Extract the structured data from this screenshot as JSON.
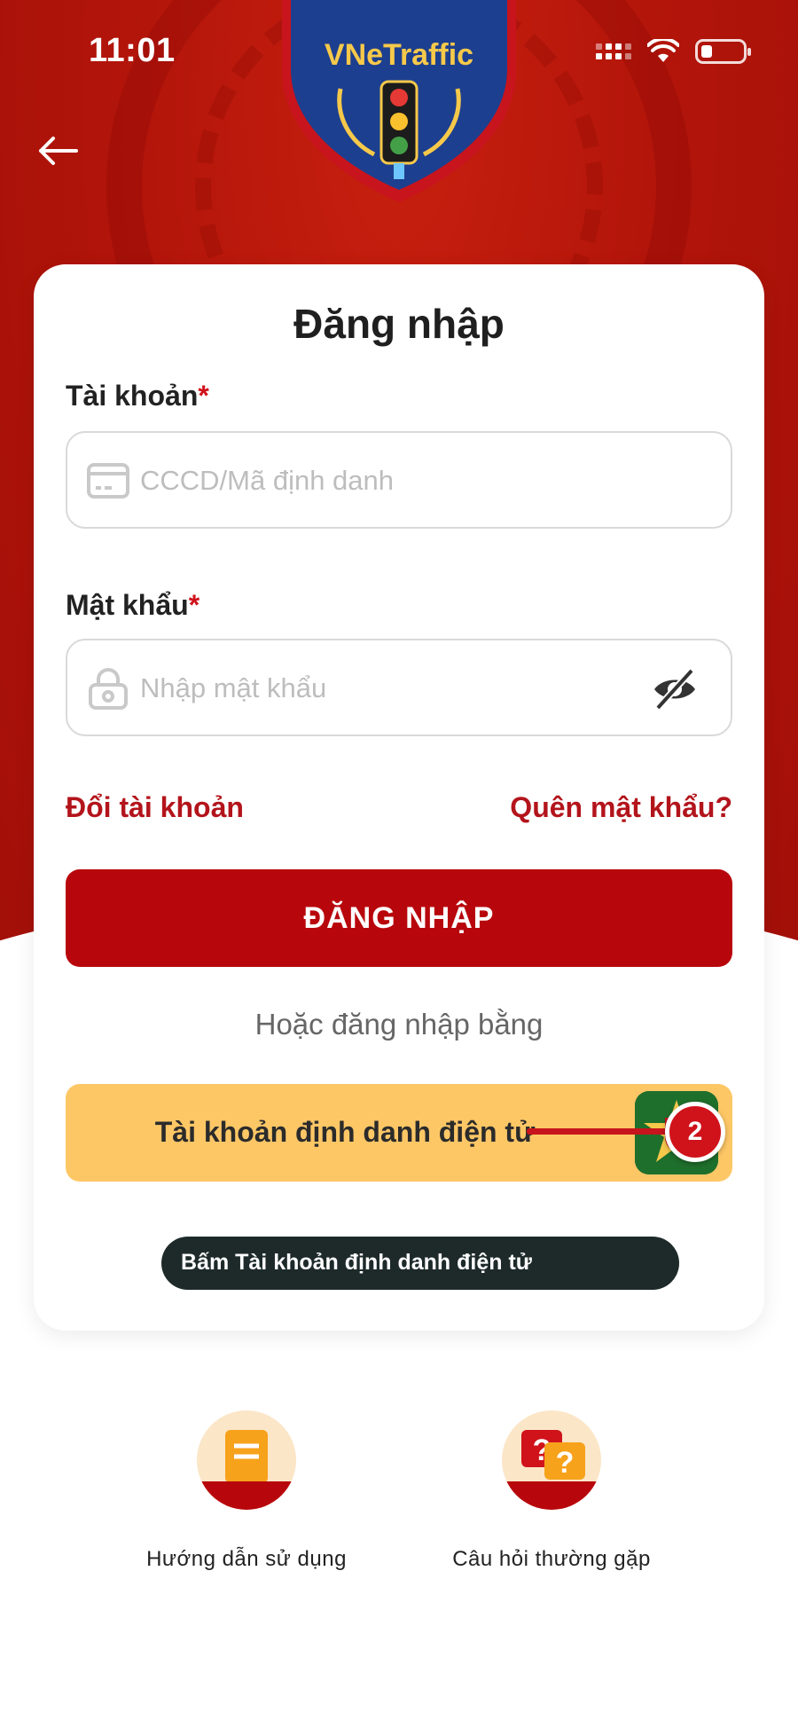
{
  "status_bar": {
    "time": "11:01"
  },
  "header": {
    "logo_text": "VNeTraffic"
  },
  "login_card": {
    "title": "Đăng nhập",
    "account_label": "Tài khoản",
    "account_placeholder": "CCCD/Mã định danh",
    "password_label": "Mật khẩu",
    "password_placeholder": "Nhập mật khẩu",
    "required_mark": "*",
    "switch_account_link": "Đổi tài khoản",
    "forgot_password_link": "Quên mật khẩu?",
    "login_button": "ĐĂNG NHẬP",
    "or_text": "Hoặc đăng nhập bằng",
    "vneid_button": "Tài khoản định danh điện tử",
    "step_badge": "2",
    "tooltip": "Bấm Tài khoản định danh điện tử"
  },
  "shortcuts": [
    {
      "label": "Hướng dẫn sử dụng",
      "icon": "document-guide-icon"
    },
    {
      "label": "Câu hỏi thường gặp",
      "icon": "faq-question-icon"
    }
  ],
  "colors": {
    "primary_red": "#b8070c",
    "link_red": "#b3141b",
    "vneid_yellow": "#fdc766",
    "tooltip_bg": "#1e2a2a"
  }
}
